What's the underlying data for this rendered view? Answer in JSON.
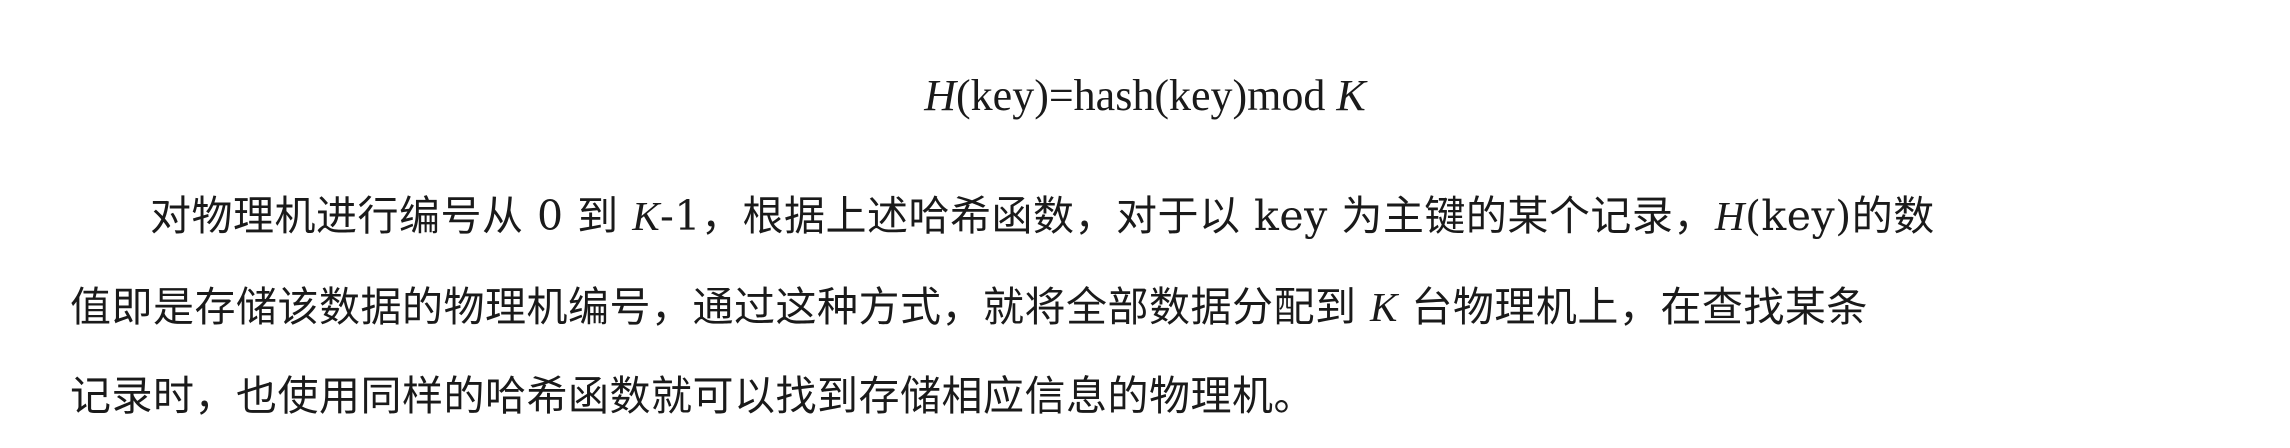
{
  "formula": {
    "h": "H",
    "mid": "(key)=hash(key)mod ",
    "k": "K"
  },
  "paragraph": {
    "line1": {
      "a": "对物理机进行编号从 0 到 ",
      "k": "K",
      "b": "-1，根据上述哈希函数，对于以 key 为主键的某个记录，",
      "h": "H",
      "c": "(key)的数"
    },
    "line2": {
      "a": "值即是存储该数据的物理机编号，通过这种方式，就将全部数据分配到 ",
      "k": "K",
      "b": " 台物理机上，在查找某条"
    },
    "line3": {
      "a": "记录时，也使用同样的哈希函数就可以找到存储相应信息的物理机。"
    }
  }
}
